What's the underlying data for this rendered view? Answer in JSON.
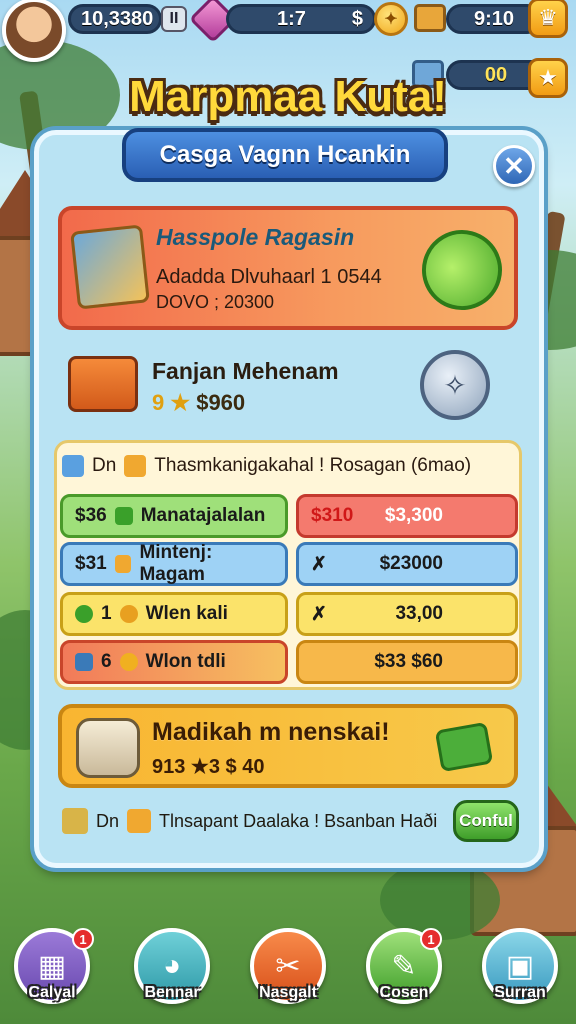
{
  "top_bar": {
    "coins": "10,3380",
    "pause_symbol": "II",
    "level_text": "1:7",
    "currency_symbol": "$",
    "time_text": "9:10",
    "secondary_value": "00"
  },
  "title": "Marpmaa Kuta!",
  "subtitle": "Casga Vagnn Hcankin",
  "close_symbol": "✕",
  "featured_card": {
    "name": "Hasspole Ragasin",
    "line1": "Adadda Dlvuhaarl 1 0544",
    "line2": "DOVO ; 20300"
  },
  "item_row": {
    "name": "Fanjan Mehenam",
    "value_prefix": "9 ★",
    "value": "$960"
  },
  "table": {
    "header_prefix": "Dn",
    "header_text": "Thasmkanigakahal ! Rosagan (6mao)",
    "left_cells": [
      {
        "amount": "$36",
        "label": "Manatajalalan"
      },
      {
        "amount": "$31",
        "label": "Mintenj: Magam"
      },
      {
        "amount": "1",
        "label": "Wlen kali"
      },
      {
        "amount": "6",
        "label": "Wlon tdli"
      }
    ],
    "right_cells": [
      {
        "tag": "$310",
        "amount": "$3,300"
      },
      {
        "tag": "✗",
        "amount": "$23000"
      },
      {
        "tag": "✗",
        "amount": "33,00"
      },
      {
        "tag": "",
        "amount": "$33 $60"
      }
    ]
  },
  "promo": {
    "title": "Madikah m nenskai!",
    "value": "913 ★3   $ 40"
  },
  "footer": {
    "prefix": "Dn",
    "text": "Tlnsapant Daalaka ! Bsanban Haði",
    "confirm_label": "Conful"
  },
  "bottom_nav": [
    {
      "label": "Calyal",
      "icon": "calendar-icon",
      "badge": "1"
    },
    {
      "label": "Bennar",
      "icon": "pet-icon",
      "badge": ""
    },
    {
      "label": "Nasgalt",
      "icon": "tools-icon",
      "badge": ""
    },
    {
      "label": "Cosen",
      "icon": "pen-icon",
      "badge": "1"
    },
    {
      "label": "Surran",
      "icon": "crate-icon",
      "badge": ""
    }
  ],
  "colors": {
    "panel": "#b9e3f3",
    "title_gold": "#ffd93b",
    "banner_blue": "#2a5fb4",
    "confirm_green": "#3f9e2a"
  }
}
